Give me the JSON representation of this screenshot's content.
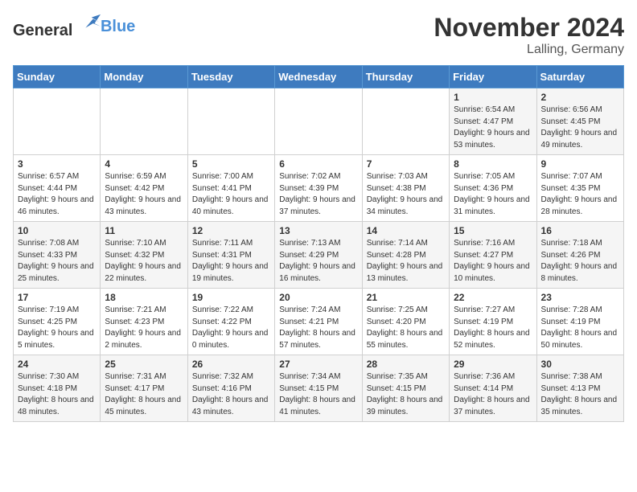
{
  "logo": {
    "text_general": "General",
    "text_blue": "Blue"
  },
  "header": {
    "month": "November 2024",
    "location": "Lalling, Germany"
  },
  "weekdays": [
    "Sunday",
    "Monday",
    "Tuesday",
    "Wednesday",
    "Thursday",
    "Friday",
    "Saturday"
  ],
  "weeks": [
    [
      {
        "day": "",
        "info": ""
      },
      {
        "day": "",
        "info": ""
      },
      {
        "day": "",
        "info": ""
      },
      {
        "day": "",
        "info": ""
      },
      {
        "day": "",
        "info": ""
      },
      {
        "day": "1",
        "info": "Sunrise: 6:54 AM\nSunset: 4:47 PM\nDaylight: 9 hours and 53 minutes."
      },
      {
        "day": "2",
        "info": "Sunrise: 6:56 AM\nSunset: 4:45 PM\nDaylight: 9 hours and 49 minutes."
      }
    ],
    [
      {
        "day": "3",
        "info": "Sunrise: 6:57 AM\nSunset: 4:44 PM\nDaylight: 9 hours and 46 minutes."
      },
      {
        "day": "4",
        "info": "Sunrise: 6:59 AM\nSunset: 4:42 PM\nDaylight: 9 hours and 43 minutes."
      },
      {
        "day": "5",
        "info": "Sunrise: 7:00 AM\nSunset: 4:41 PM\nDaylight: 9 hours and 40 minutes."
      },
      {
        "day": "6",
        "info": "Sunrise: 7:02 AM\nSunset: 4:39 PM\nDaylight: 9 hours and 37 minutes."
      },
      {
        "day": "7",
        "info": "Sunrise: 7:03 AM\nSunset: 4:38 PM\nDaylight: 9 hours and 34 minutes."
      },
      {
        "day": "8",
        "info": "Sunrise: 7:05 AM\nSunset: 4:36 PM\nDaylight: 9 hours and 31 minutes."
      },
      {
        "day": "9",
        "info": "Sunrise: 7:07 AM\nSunset: 4:35 PM\nDaylight: 9 hours and 28 minutes."
      }
    ],
    [
      {
        "day": "10",
        "info": "Sunrise: 7:08 AM\nSunset: 4:33 PM\nDaylight: 9 hours and 25 minutes."
      },
      {
        "day": "11",
        "info": "Sunrise: 7:10 AM\nSunset: 4:32 PM\nDaylight: 9 hours and 22 minutes."
      },
      {
        "day": "12",
        "info": "Sunrise: 7:11 AM\nSunset: 4:31 PM\nDaylight: 9 hours and 19 minutes."
      },
      {
        "day": "13",
        "info": "Sunrise: 7:13 AM\nSunset: 4:29 PM\nDaylight: 9 hours and 16 minutes."
      },
      {
        "day": "14",
        "info": "Sunrise: 7:14 AM\nSunset: 4:28 PM\nDaylight: 9 hours and 13 minutes."
      },
      {
        "day": "15",
        "info": "Sunrise: 7:16 AM\nSunset: 4:27 PM\nDaylight: 9 hours and 10 minutes."
      },
      {
        "day": "16",
        "info": "Sunrise: 7:18 AM\nSunset: 4:26 PM\nDaylight: 9 hours and 8 minutes."
      }
    ],
    [
      {
        "day": "17",
        "info": "Sunrise: 7:19 AM\nSunset: 4:25 PM\nDaylight: 9 hours and 5 minutes."
      },
      {
        "day": "18",
        "info": "Sunrise: 7:21 AM\nSunset: 4:23 PM\nDaylight: 9 hours and 2 minutes."
      },
      {
        "day": "19",
        "info": "Sunrise: 7:22 AM\nSunset: 4:22 PM\nDaylight: 9 hours and 0 minutes."
      },
      {
        "day": "20",
        "info": "Sunrise: 7:24 AM\nSunset: 4:21 PM\nDaylight: 8 hours and 57 minutes."
      },
      {
        "day": "21",
        "info": "Sunrise: 7:25 AM\nSunset: 4:20 PM\nDaylight: 8 hours and 55 minutes."
      },
      {
        "day": "22",
        "info": "Sunrise: 7:27 AM\nSunset: 4:19 PM\nDaylight: 8 hours and 52 minutes."
      },
      {
        "day": "23",
        "info": "Sunrise: 7:28 AM\nSunset: 4:19 PM\nDaylight: 8 hours and 50 minutes."
      }
    ],
    [
      {
        "day": "24",
        "info": "Sunrise: 7:30 AM\nSunset: 4:18 PM\nDaylight: 8 hours and 48 minutes."
      },
      {
        "day": "25",
        "info": "Sunrise: 7:31 AM\nSunset: 4:17 PM\nDaylight: 8 hours and 45 minutes."
      },
      {
        "day": "26",
        "info": "Sunrise: 7:32 AM\nSunset: 4:16 PM\nDaylight: 8 hours and 43 minutes."
      },
      {
        "day": "27",
        "info": "Sunrise: 7:34 AM\nSunset: 4:15 PM\nDaylight: 8 hours and 41 minutes."
      },
      {
        "day": "28",
        "info": "Sunrise: 7:35 AM\nSunset: 4:15 PM\nDaylight: 8 hours and 39 minutes."
      },
      {
        "day": "29",
        "info": "Sunrise: 7:36 AM\nSunset: 4:14 PM\nDaylight: 8 hours and 37 minutes."
      },
      {
        "day": "30",
        "info": "Sunrise: 7:38 AM\nSunset: 4:13 PM\nDaylight: 8 hours and 35 minutes."
      }
    ]
  ]
}
